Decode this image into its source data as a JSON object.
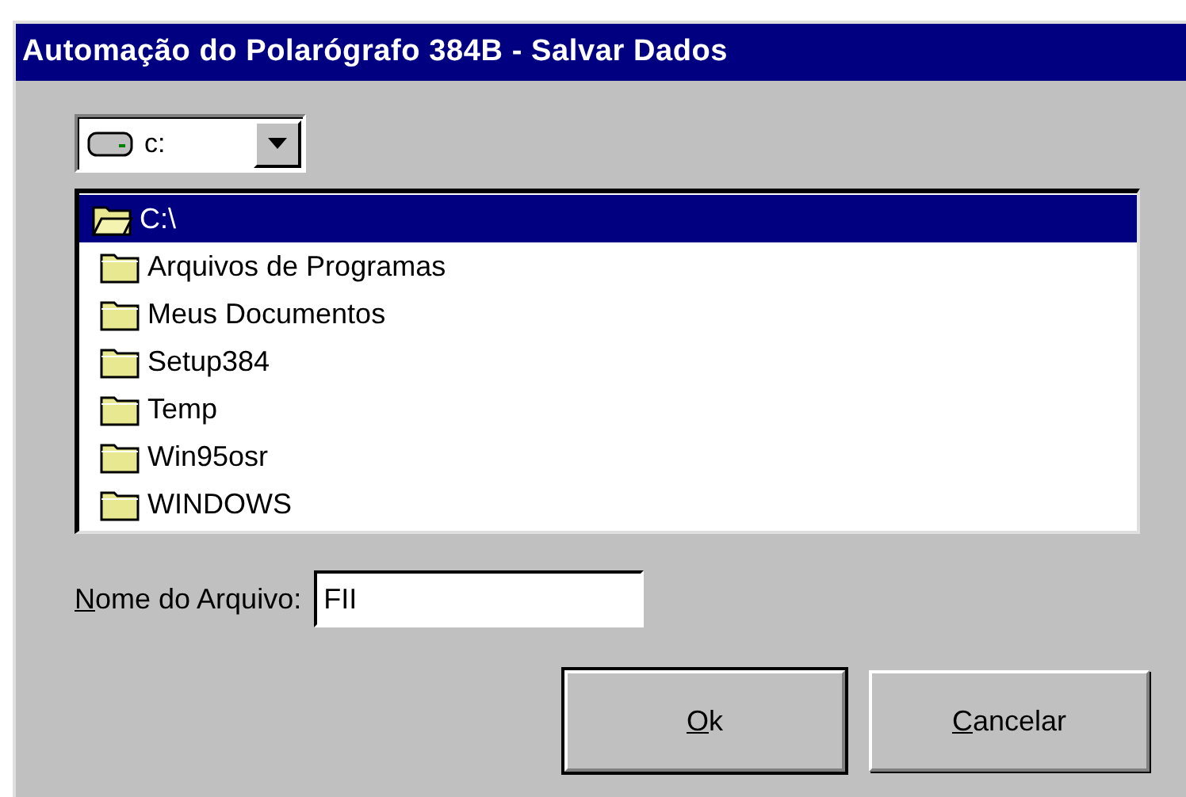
{
  "window": {
    "title": "Automação do Polarógrafo 384B - Salvar Dados"
  },
  "drive": {
    "value": "c:"
  },
  "folders": [
    {
      "name": "C:\\",
      "open": true,
      "selected": true
    },
    {
      "name": "Arquivos de Programas",
      "open": false,
      "selected": false
    },
    {
      "name": "Meus Documentos",
      "open": false,
      "selected": false
    },
    {
      "name": "Setup384",
      "open": false,
      "selected": false
    },
    {
      "name": "Temp",
      "open": false,
      "selected": false
    },
    {
      "name": "Win95osr",
      "open": false,
      "selected": false
    },
    {
      "name": "WINDOWS",
      "open": false,
      "selected": false
    }
  ],
  "file_name": {
    "label": "Nome do Arquivo:",
    "value": "FII"
  },
  "buttons": [
    {
      "label": "Ok",
      "default": true
    },
    {
      "label": "Cancelar",
      "default": false
    }
  ]
}
